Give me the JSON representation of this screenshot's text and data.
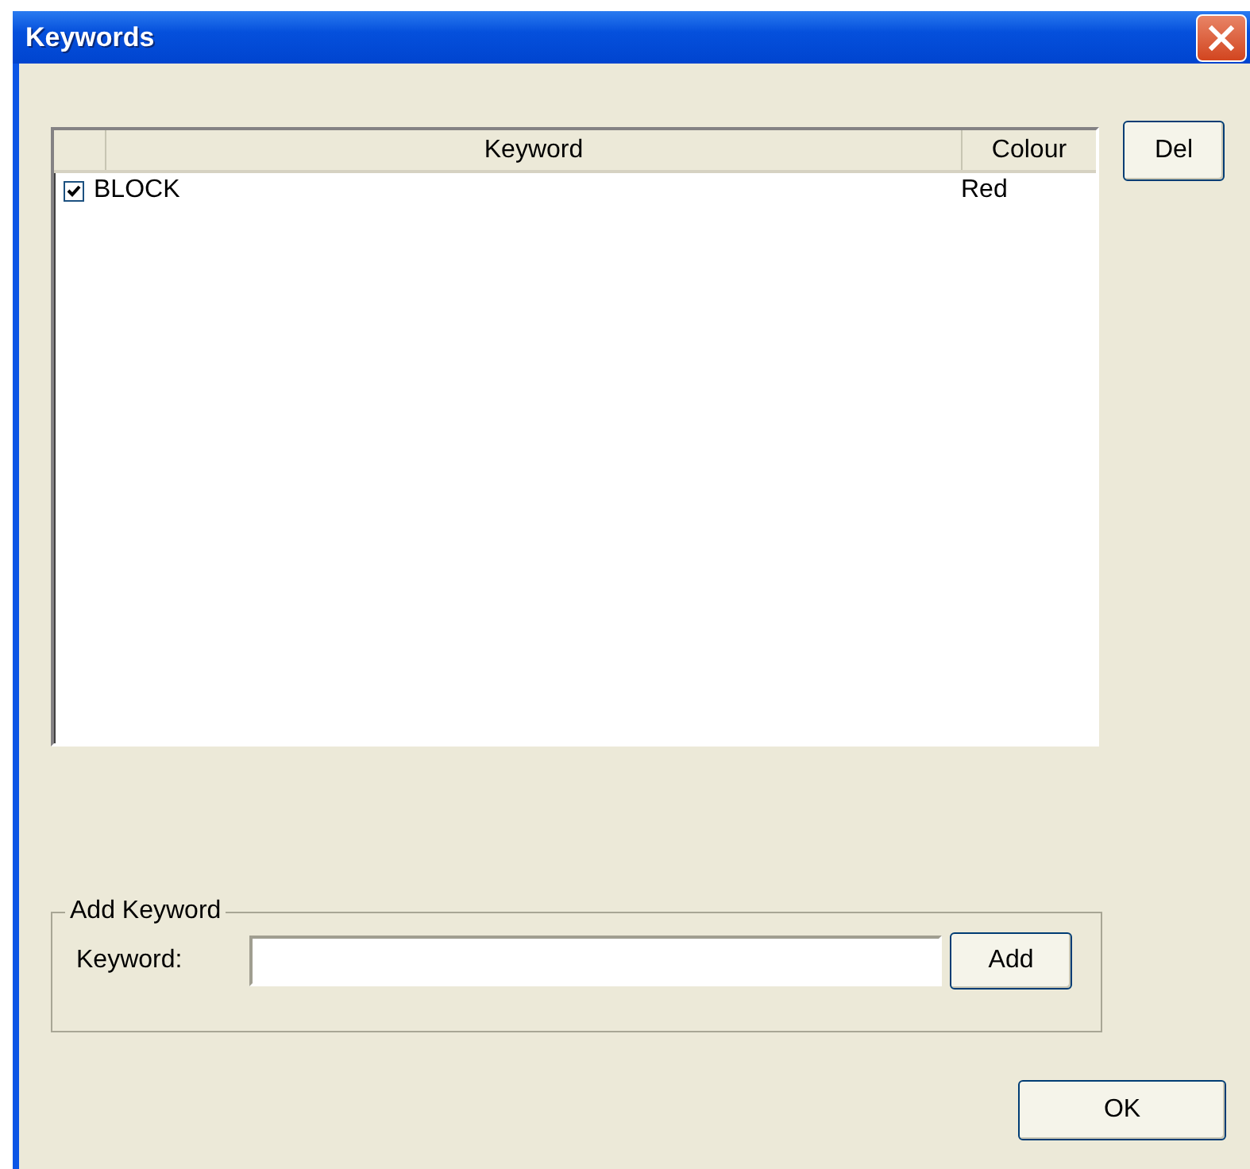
{
  "window": {
    "title": "Keywords"
  },
  "table": {
    "columns": [
      {
        "label": "Keyword"
      },
      {
        "label": "Colour"
      }
    ],
    "rows": [
      {
        "checked": true,
        "keyword": "BLOCK",
        "colour": "Red"
      }
    ]
  },
  "buttons": {
    "delete": "Del",
    "ok": "OK"
  },
  "add_keyword": {
    "legend": "Add Keyword",
    "label": "Keyword:",
    "button": "Add"
  }
}
